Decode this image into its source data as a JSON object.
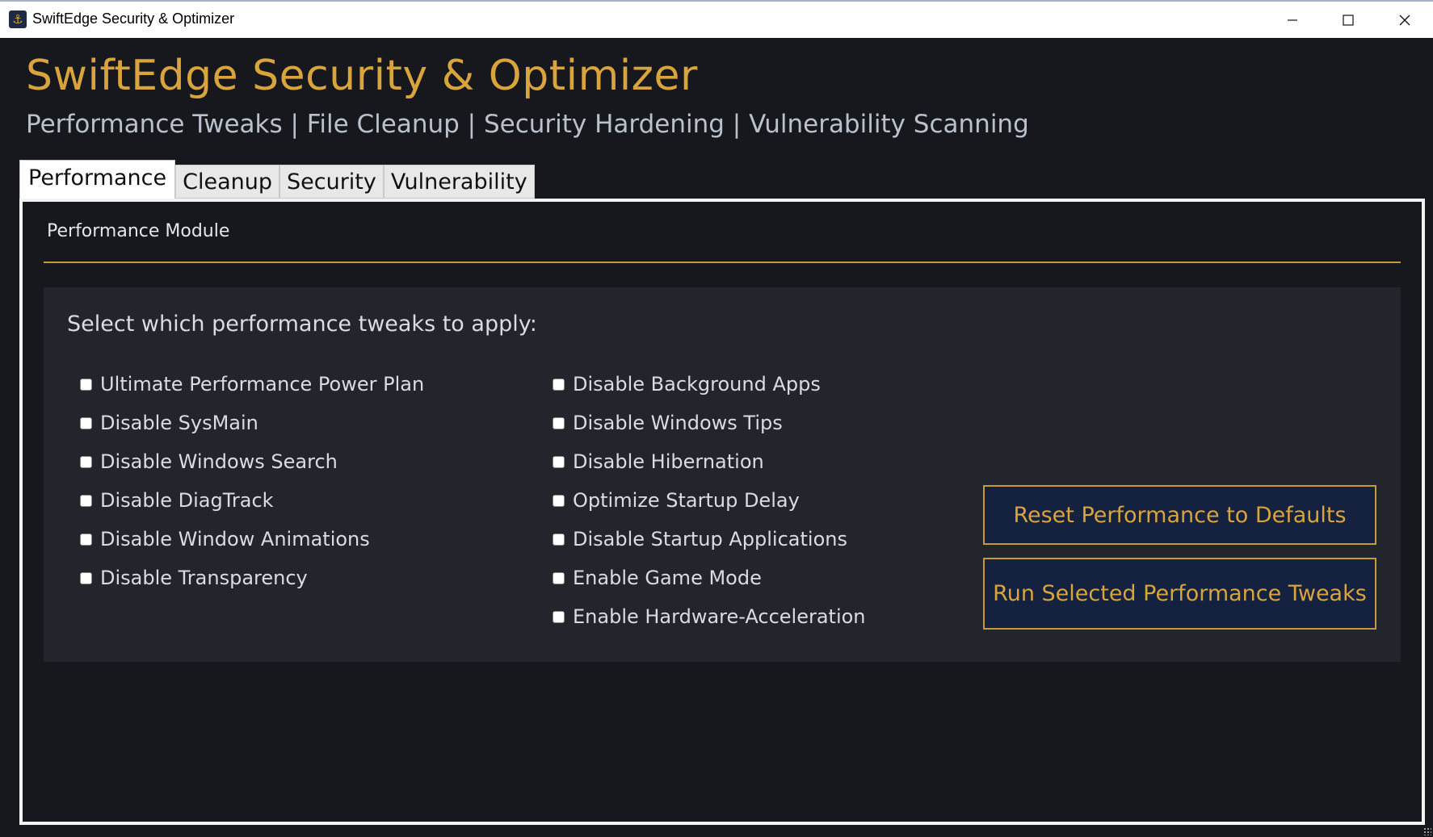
{
  "window": {
    "title": "SwiftEdge Security & Optimizer",
    "app_icon": "anchor-icon",
    "controls": [
      "minimize-icon",
      "maximize-icon",
      "close-icon"
    ]
  },
  "header": {
    "title": "SwiftEdge Security & Optimizer",
    "subtitle": "Performance Tweaks | File Cleanup | Security Hardening | Vulnerability Scanning"
  },
  "tabs": [
    {
      "label": "Performance",
      "active": true
    },
    {
      "label": "Cleanup",
      "active": false
    },
    {
      "label": "Security",
      "active": false
    },
    {
      "label": "Vulnerability",
      "active": false
    }
  ],
  "module": {
    "title": "Performance Module",
    "prompt": "Select which performance tweaks to apply:",
    "options_left": [
      {
        "label": "Ultimate Performance Power Plan",
        "checked": false
      },
      {
        "label": "Disable SysMain",
        "checked": false
      },
      {
        "label": "Disable Windows Search",
        "checked": false
      },
      {
        "label": "Disable DiagTrack",
        "checked": false
      },
      {
        "label": "Disable Window Animations",
        "checked": false
      },
      {
        "label": "Disable Transparency",
        "checked": false
      }
    ],
    "options_right": [
      {
        "label": "Disable Background Apps",
        "checked": false
      },
      {
        "label": "Disable Windows Tips",
        "checked": false
      },
      {
        "label": "Disable Hibernation",
        "checked": false
      },
      {
        "label": "Optimize Startup Delay",
        "checked": false
      },
      {
        "label": "Disable Startup Applications",
        "checked": false
      },
      {
        "label": "Enable Game Mode",
        "checked": false
      },
      {
        "label": "Enable Hardware-Acceleration",
        "checked": false
      }
    ],
    "reset_button": "Reset Performance to Defaults",
    "run_button": "Run Selected Performance Tweaks"
  },
  "colors": {
    "accent": "#d9a43b",
    "background": "#16181d",
    "panel": "#22262c",
    "button_bg": "#14213f"
  }
}
